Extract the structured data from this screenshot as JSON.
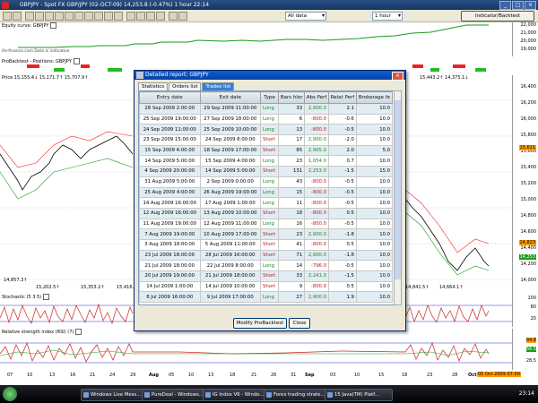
{
  "window": {
    "title": "GBPJPY - Spot FX GBP/JPY (02-OCT-09)   14,253.8 (-0.47%)   1 hour   22:14"
  },
  "toolbar": {
    "range": "All data",
    "interval": "1 hour",
    "indicator_button": "Indicator/Backtest"
  },
  "panes": {
    "equity": {
      "title": "Equity curve: GBPJPY",
      "subtitle": "ifo-finance.com  Data is indicative",
      "ticks": [
        "22,000",
        "21,000",
        "20,000",
        "19,000"
      ]
    },
    "backtest": {
      "title": "ProBacktest - Positions: GBPJPY"
    },
    "price": {
      "title": "Price  15,155.4↓  15,171.7↑  15,707.9↑",
      "mid_label": "15,443.2↑  14,375.1↓",
      "ticks": [
        "16,400",
        "16,200",
        "16,000",
        "15,800",
        "15,600",
        "15,400",
        "15,200",
        "15,000",
        "14,800",
        "14,600",
        "14,400",
        "14,200",
        "14,000"
      ],
      "highlight_value": "15,611",
      "highlight2": "14,823",
      "highlight3": "14,253",
      "bottom_labels": [
        "14,857.3↑",
        "15,202.5↑",
        "15,353.2↑",
        "15,416.8",
        "14,841.5↑",
        "14,664.1↑"
      ]
    },
    "stochastic": {
      "title": "Stochastic (5 3 5)",
      "ticks": [
        "100",
        "80",
        "20"
      ]
    },
    "rsi": {
      "title": "Relative strength index (RSI) (7)",
      "ticks": [
        "84.8",
        "56.5",
        "28.5"
      ]
    }
  },
  "xaxis": {
    "labels": [
      "07",
      "10",
      "13",
      "16",
      "21",
      "24",
      "29",
      "Aug",
      "05",
      "10",
      "13",
      "18",
      "21",
      "26",
      "31",
      "Sep",
      "03",
      "10",
      "15",
      "18",
      "23",
      "28",
      "Oct"
    ],
    "date_box": "05 Oct 2009 07:00"
  },
  "dialog": {
    "title": "Detailed report: GBPJPY",
    "tabs": [
      "Statistics",
      "Orders list",
      "Trades list"
    ],
    "columns": [
      "Entry date",
      "Exit date",
      "Type",
      "Bars hlor",
      "Abs Perf",
      "Relat Perf",
      "Brokerage fe"
    ],
    "rows": [
      [
        "28 Sep 2009 2:00:00",
        "29 Sep 2009 11:00:00",
        "Long",
        "33",
        "2,900.0",
        "2.1",
        "10.0"
      ],
      [
        "25 Sep 2009 19:00:00",
        "27 Sep 2009 18:00:00",
        "Long",
        "6",
        "-800.0",
        "-0.6",
        "10.0"
      ],
      [
        "24 Sep 2009 11:00:00",
        "25 Sep 2009 10:00:00",
        "Long",
        "13",
        "-800.0",
        "-0.5",
        "10.0"
      ],
      [
        "23 Sep 2009 15:00:00",
        "24 Sep 2009 8:00:00",
        "Short",
        "17",
        "2,900.0",
        "-2.0",
        "10.0"
      ],
      [
        "15 Sep 2009 4:00:00",
        "18 Sep 2009 17:00:00",
        "Short",
        "85",
        "2,905.0",
        "2.0",
        "5.0"
      ],
      [
        "14 Sep 2009 5:00:00",
        "15 Sep 2009 4:00:00",
        "Long",
        "23",
        "1,054.0",
        "0.7",
        "10.0"
      ],
      [
        "4 Sep 2009 20:00:00",
        "14 Sep 2009 5:00:00",
        "Short",
        "131",
        "2,253.0",
        "-1.5",
        "15.0"
      ],
      [
        "31 Aug 2009 5:00:00",
        "2 Sep 2009 0:00:00",
        "Long",
        "43",
        "-800.0",
        "-0.5",
        "10.0"
      ],
      [
        "25 Aug 2009 4:00:00",
        "26 Aug 2009 19:00:00",
        "Long",
        "15",
        "-800.0",
        "-0.5",
        "10.0"
      ],
      [
        "14 Aug 2009 16:00:00",
        "17 Aug 2009 1:00:00",
        "Long",
        "11",
        "-800.0",
        "-0.5",
        "10.0"
      ],
      [
        "12 Aug 2009 16:00:00",
        "13 Aug 2009 10:00:00",
        "Short",
        "18",
        "-800.0",
        "0.5",
        "10.0"
      ],
      [
        "11 Aug 2009 19:00:00",
        "12 Aug 2009 11:00:00",
        "Long",
        "16",
        "-800.0",
        "-0.5",
        "10.0"
      ],
      [
        "7 Aug 2009 19:00:00",
        "10 Aug 2009 17:00:00",
        "Short",
        "23",
        "2,900.0",
        "-1.8",
        "10.0"
      ],
      [
        "3 Aug 2009 18:00:00",
        "5 Aug 2009 11:00:00",
        "Short",
        "41",
        "-800.0",
        "0.5",
        "10.0"
      ],
      [
        "23 Jul 2009 18:00:00",
        "28 Jul 2009 16:00:00",
        "Short",
        "71",
        "2,900.0",
        "-1.8",
        "10.0"
      ],
      [
        "21 Jul 2009 18:00:00",
        "22 Jul 2009 8:00:00",
        "Long",
        "14",
        "-796.0",
        "-0.5",
        "10.0"
      ],
      [
        "20 Jul 2009 19:00:00",
        "21 Jul 2009 18:00:00",
        "Short",
        "33",
        "2,241.0",
        "-1.5",
        "10.0"
      ],
      [
        "14 Jul 2009 1:00:00",
        "14 Jul 2009 10:00:00",
        "Short",
        "9",
        "-800.0",
        "0.5",
        "10.0"
      ],
      [
        "8 Jul 2009 16:00:00",
        "9 Jul 2009 17:00:00",
        "Long",
        "27",
        "2,900.0",
        "1.9",
        "10.0"
      ]
    ],
    "buttons": {
      "modify": "Modify ProBacktest",
      "close": "Close"
    }
  },
  "taskbar": {
    "tasks": [
      "Windows Live Mess...",
      "PureDeal - Windows...",
      "IG Index V6 - Windo...",
      "Forex trading strate...",
      "15 Java(TM) Platf..."
    ],
    "clock": "23:14"
  }
}
